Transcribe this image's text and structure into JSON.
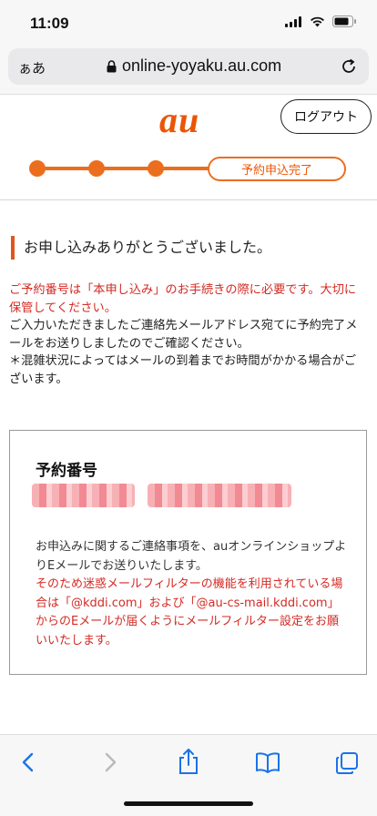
{
  "status_bar": {
    "time": "11:09"
  },
  "browser": {
    "text_size_label": "ぁあ",
    "url": "online-yoyaku.au.com"
  },
  "header": {
    "logo_text": "au",
    "logout_label": "ログアウト"
  },
  "steps": {
    "current_label": "予約申込完了",
    "completed_count": 3
  },
  "main": {
    "heading": "お申し込みありがとうございました。",
    "notice_red": "ご予約番号は「本申し込み」のお手続きの際に必要です。大切に保管してください。",
    "notice_body": "ご入力いただきましたご連絡先メールアドレス宛てに予約完了メールをお送りしましたのでご確認ください。",
    "notice_note": "＊混雑状況によってはメールの到着までお時間がかかる場合がございます。"
  },
  "reservation_box": {
    "title": "予約番号",
    "info_text": "お申込みに関するご連絡事項を、auオンラインショップよりEメールでお送りいたします。",
    "warning_text": "そのため迷惑メールフィルターの機能を利用されている場合は「@kddi.com」および「@au-cs-mail.kddi.com」からのEメールが届くようにメールフィルター設定をお願いいたします。"
  },
  "toolbar": {
    "icons": [
      "back-icon",
      "forward-icon",
      "share-icon",
      "bookmarks-icon",
      "tabs-icon"
    ]
  },
  "colors": {
    "brand": "#eb5505",
    "accent_red": "#d42a23",
    "step": "#eb6e1e"
  }
}
